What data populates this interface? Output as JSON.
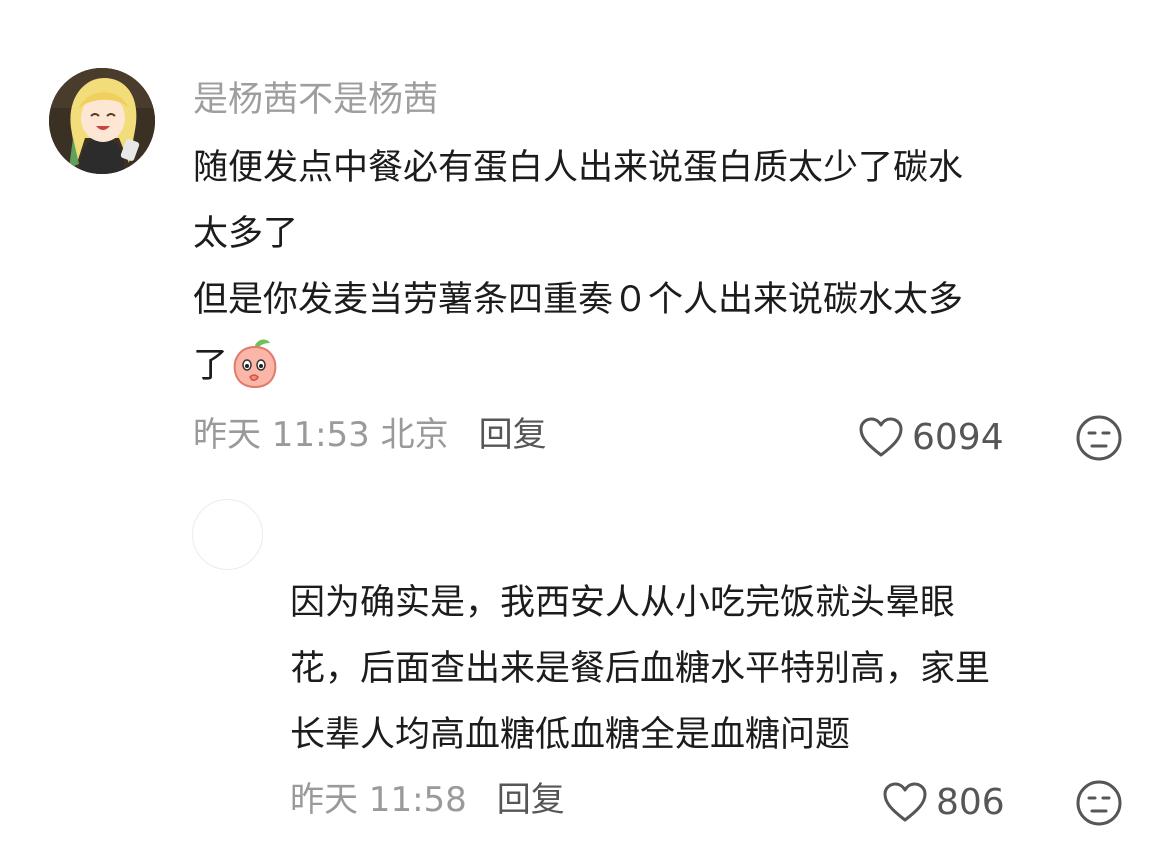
{
  "comment": {
    "username": "是杨茜不是杨茜",
    "lines": [
      "随便发点中餐必有蛋白人出来说蛋白质太少了碳水",
      "太多了",
      "但是你发麦当劳薯条四重奏０个人出来说碳水太多",
      "了"
    ],
    "emoji": "peach-shy-emoji",
    "time": "昨天 11:53 北京",
    "reply_label": "回复",
    "likes": "6094"
  },
  "reply": {
    "lines": [
      "因为确实是，我西安人从小吃完饭就头晕眼",
      "花，后面查出来是餐后血糖水平特别高，家里",
      "长辈人均高血糖低血糖全是血糖问题"
    ],
    "time": "昨天 11:58",
    "reply_label": "回复",
    "likes": "806"
  },
  "icons": {
    "like": "heart-outline-icon",
    "dislike": "meh-face-icon"
  },
  "colors": {
    "username": "#9e9e9e",
    "text": "#1c1c1c",
    "meta": "#9a9a9a",
    "action": "#565656"
  }
}
